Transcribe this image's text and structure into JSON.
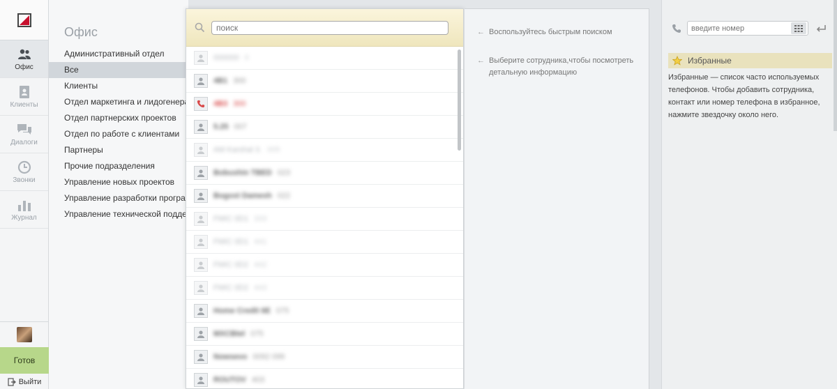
{
  "nav": {
    "items": [
      {
        "label": "Офис",
        "icon": "people-icon",
        "active": true
      },
      {
        "label": "Клиенты",
        "icon": "contacts-book-icon",
        "active": false
      },
      {
        "label": "Диалоги",
        "icon": "chat-bubbles-icon",
        "active": false
      },
      {
        "label": "Звонки",
        "icon": "clock-icon",
        "active": false
      },
      {
        "label": "Журнал",
        "icon": "bar-chart-icon",
        "active": false
      }
    ],
    "status_label": "Готов",
    "exit_label": "Выйти"
  },
  "departments": {
    "title": "Офис",
    "items": [
      "Административный отдел",
      "Все",
      "Клиенты",
      "Отдел маркетинга и лидогенерации",
      "Отдел партнерских проектов",
      "Отдел по работе с клиентами",
      "Партнеры",
      "Прочие подразделения",
      "Управление новых проектов",
      "Управление разработки программного обеспечения",
      "Управление технической поддержки"
    ],
    "selected_index": 1
  },
  "employees": {
    "search_placeholder": "поиск",
    "rows": [
      {
        "name": "000000",
        "ext": "0",
        "style": "faded"
      },
      {
        "name": "4B1",
        "ext": "300",
        "style": "normal"
      },
      {
        "name": "4B3",
        "ext": "300",
        "style": "red"
      },
      {
        "name": "5.25",
        "ext": "007",
        "style": "normal"
      },
      {
        "name": "AM Karshal 3.",
        "ext": "005",
        "style": "faded"
      },
      {
        "name": "Bobushin TBED",
        "ext": "023",
        "style": "normal"
      },
      {
        "name": "Bogost Damesh",
        "ext": "022",
        "style": "normal"
      },
      {
        "name": "FMIC 0D1",
        "ext": "333",
        "style": "faded"
      },
      {
        "name": "FMIC 0D1",
        "ext": "441",
        "style": "faded"
      },
      {
        "name": "FMIC 0D2",
        "ext": "442",
        "style": "faded"
      },
      {
        "name": "FMIC 0D2",
        "ext": "443",
        "style": "faded"
      },
      {
        "name": "Home Credit 6E",
        "ext": "075",
        "style": "normal"
      },
      {
        "name": "MXCBtel",
        "ext": "075",
        "style": "normal"
      },
      {
        "name": "Nowsevo",
        "ext": "0092 099",
        "style": "normal"
      },
      {
        "name": "ROUTOV",
        "ext": "403",
        "style": "normal"
      }
    ]
  },
  "info": {
    "hint_search": "Воспользуйтесь быстрым поиском",
    "hint_select": "Выберите сотрудника,чтобы посмотреть детальную информацию"
  },
  "dialer": {
    "placeholder": "введите номер"
  },
  "favorites": {
    "title": "Избранные",
    "description": "Избранные — список часто используемых телефонов. Чтобы добавить сотрудника, контакт или номер телефона в избранное, нажмите звездочку около него."
  },
  "colors": {
    "status_ready": "#b7d78a",
    "favorites_bg": "#e9e2bd",
    "missed_call": "#d94a4a",
    "logo_red": "#c8102e"
  }
}
